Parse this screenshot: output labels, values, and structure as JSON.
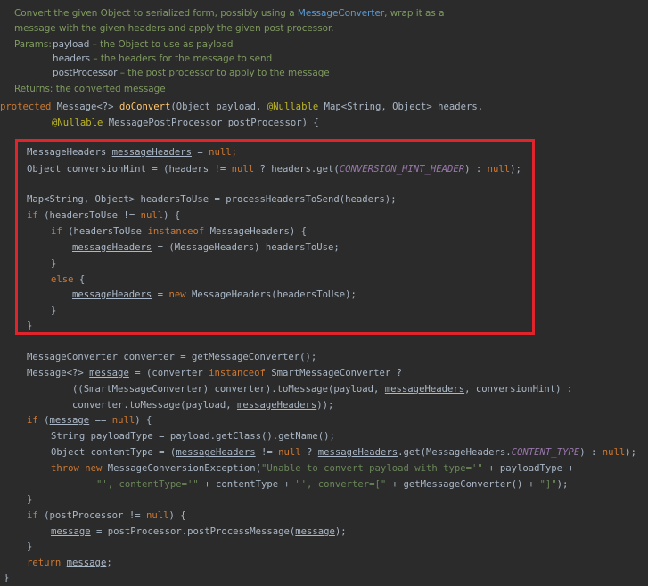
{
  "doc": {
    "summary_1_pre": "Convert the given Object to serialized form, possibly using a ",
    "summary_1_link": "MessageConverter",
    "summary_1_post": ", wrap it as a",
    "summary_2": "message with the given headers and apply the given post processor.",
    "params_label": "Params:",
    "params": [
      {
        "name": "payload",
        "desc": " – the Object to use as payload"
      },
      {
        "name": "headers",
        "desc": " – the headers for the message to send"
      },
      {
        "name": "postProcessor",
        "desc": " – the post processor to apply to the message"
      }
    ],
    "returns": "Returns: the converted message"
  },
  "code": {
    "sig_1": {
      "protected": "protected ",
      "type": "Message<?> ",
      "fn": "doConvert",
      "open": "(Object payload, ",
      "ann": "@Nullable",
      "rest": " Map<String, Object> headers,"
    },
    "sig_2": {
      "ann": "@Nullable",
      "rest": " MessagePostProcessor postProcessor) {"
    },
    "l1": {
      "type": "MessageHeaders ",
      "var": "messageHeaders",
      "eq": " = ",
      "null": "null",
      "semi": ";"
    },
    "l2": {
      "a": "Object conversionHint = (headers != ",
      "null": "null",
      "b": " ? headers.get(",
      "const": "CONVERSION_HINT_HEADER",
      "c": ") : ",
      "null2": "null",
      "d": ");"
    },
    "l3": "Map<String, Object> headersToUse = processHeadersToSend(headers);",
    "l4": {
      "if": "if",
      "a": " (headersToUse != ",
      "null": "null",
      "b": ") {"
    },
    "l5": {
      "if": "if",
      "a": " (headersToUse ",
      "instanceof": "instanceof",
      "b": " MessageHeaders) {"
    },
    "l6": {
      "var": "messageHeaders",
      "a": " = (MessageHeaders) headersToUse;"
    },
    "l7": "}",
    "l8": {
      "else": "else",
      "a": " {"
    },
    "l9": {
      "var": "messageHeaders",
      "a": " = ",
      "new": "new",
      "b": " MessageHeaders(headersToUse);"
    },
    "l10": "}",
    "l11": "}",
    "l12": "MessageConverter converter = getMessageConverter();",
    "l13": {
      "a": "Message<?> ",
      "var": "message",
      "b": " = (converter ",
      "instanceof": "instanceof",
      "c": " SmartMessageConverter ?"
    },
    "l14": {
      "a": "((SmartMessageConverter) converter).toMessage(payload, ",
      "var": "messageHeaders",
      "b": ", conversionHint) :"
    },
    "l15": {
      "a": "converter.toMessage(payload, ",
      "var": "messageHeaders",
      "b": "));"
    },
    "l16": {
      "if": "if",
      "a": " (",
      "var": "message",
      "b": " == ",
      "null": "null",
      "c": ") {"
    },
    "l17": "String payloadType = payload.getClass().getName();",
    "l18": {
      "a": "Object contentType = (",
      "var": "messageHeaders",
      "b": " != ",
      "null": "null",
      "c": " ? ",
      "var2": "messageHeaders",
      "d": ".get(MessageHeaders.",
      "const": "CONTENT_TYPE",
      "e": ") : ",
      "null2": "null",
      "f": ");"
    },
    "l19": {
      "throw": "throw",
      "new": " new",
      "a": " MessageConversionException(",
      "s1": "\"Unable to convert payload with type='\"",
      "b": " + payloadType +"
    },
    "l20": {
      "s1": "\"', contentType='\"",
      "a": " + contentType + ",
      "s2": "\"', converter=[\"",
      "b": " + getMessageConverter() + ",
      "s3": "\"]\"",
      "c": ");"
    },
    "l21": "}",
    "l22": {
      "if": "if",
      "a": " (postProcessor != ",
      "null": "null",
      "b": ") {"
    },
    "l23": {
      "var": "message",
      "a": " = postProcessor.postProcessMessage(",
      "var2": "message",
      "b": ");"
    },
    "l24": "}",
    "l25": {
      "return": "return",
      "a": " ",
      "var": "message",
      "b": ";"
    },
    "l26": "}"
  },
  "colors": {
    "highlight_box": "#e0242b",
    "background": "#2b2b2b"
  }
}
